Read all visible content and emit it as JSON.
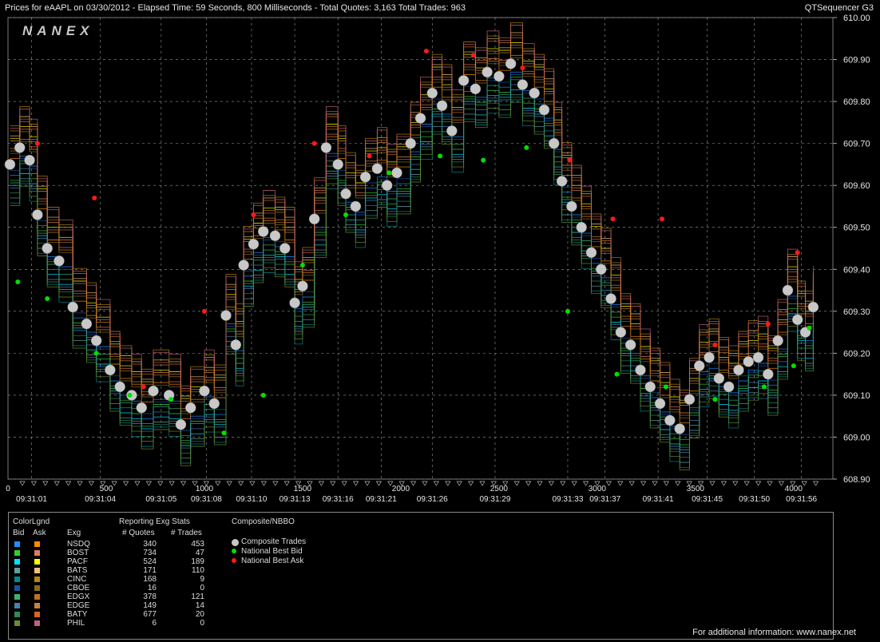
{
  "header": {
    "title": "Prices for  eAAPL  on  03/30/2012  -  Elapsed Time: 59 Seconds, 800 Milliseconds  -  Total Quotes: 3,163  Total Trades: 963",
    "app": "QTSequencer G3",
    "logo": "NANEX"
  },
  "chart_data": {
    "type": "scatter",
    "title": "",
    "xlabel": "",
    "ylabel": "",
    "ylim": [
      608.9,
      610.0
    ],
    "xlim": [
      0,
      4200
    ],
    "y_ticks": [
      "610.00",
      "609.90",
      "609.80",
      "609.70",
      "609.60",
      "609.50",
      "609.40",
      "609.30",
      "609.20",
      "609.10",
      "609.00",
      "608.90"
    ],
    "x_ticks": [
      {
        "v": 0,
        "label": "0"
      },
      {
        "v": 500,
        "label": "500"
      },
      {
        "v": 1000,
        "label": "1000"
      },
      {
        "v": 1500,
        "label": "1500"
      },
      {
        "v": 2000,
        "label": "2000"
      },
      {
        "v": 2500,
        "label": "2500"
      },
      {
        "v": 3000,
        "label": "3000"
      },
      {
        "v": 3500,
        "label": "3500"
      },
      {
        "v": 4000,
        "label": "4000"
      }
    ],
    "time_labels": [
      {
        "v": 120,
        "label": "09:31:01"
      },
      {
        "v": 470,
        "label": "09:31:04"
      },
      {
        "v": 780,
        "label": "09:31:05"
      },
      {
        "v": 1010,
        "label": "09:31:08"
      },
      {
        "v": 1240,
        "label": "09:31:10"
      },
      {
        "v": 1460,
        "label": "09:31:13"
      },
      {
        "v": 1680,
        "label": "09:31:16"
      },
      {
        "v": 1900,
        "label": "09:31:21"
      },
      {
        "v": 2160,
        "label": "09:31:26"
      },
      {
        "v": 2480,
        "label": "09:31:29"
      },
      {
        "v": 2850,
        "label": "09:31:33"
      },
      {
        "v": 3040,
        "label": "09:31:37"
      },
      {
        "v": 3310,
        "label": "09:31:41"
      },
      {
        "v": 3560,
        "label": "09:31:45"
      },
      {
        "v": 3800,
        "label": "09:31:50"
      },
      {
        "v": 4040,
        "label": "09:31:56"
      }
    ],
    "grid": true,
    "legend_position": "bottom",
    "series": [
      {
        "name": "Composite Trades",
        "color": "#c8c8c8",
        "marker": "circle",
        "points": [
          [
            10,
            609.65
          ],
          [
            60,
            609.69
          ],
          [
            110,
            609.66
          ],
          [
            150,
            609.53
          ],
          [
            200,
            609.45
          ],
          [
            260,
            609.42
          ],
          [
            330,
            609.31
          ],
          [
            400,
            609.27
          ],
          [
            450,
            609.23
          ],
          [
            520,
            609.16
          ],
          [
            570,
            609.12
          ],
          [
            630,
            609.1
          ],
          [
            680,
            609.07
          ],
          [
            740,
            609.11
          ],
          [
            820,
            609.1
          ],
          [
            880,
            609.03
          ],
          [
            930,
            609.07
          ],
          [
            1000,
            609.11
          ],
          [
            1050,
            609.08
          ],
          [
            1110,
            609.29
          ],
          [
            1160,
            609.22
          ],
          [
            1200,
            609.41
          ],
          [
            1250,
            609.46
          ],
          [
            1300,
            609.49
          ],
          [
            1360,
            609.48
          ],
          [
            1410,
            609.45
          ],
          [
            1460,
            609.32
          ],
          [
            1500,
            609.36
          ],
          [
            1560,
            609.52
          ],
          [
            1620,
            609.69
          ],
          [
            1680,
            609.65
          ],
          [
            1720,
            609.58
          ],
          [
            1770,
            609.55
          ],
          [
            1820,
            609.62
          ],
          [
            1880,
            609.64
          ],
          [
            1930,
            609.6
          ],
          [
            1980,
            609.63
          ],
          [
            2050,
            609.7
          ],
          [
            2100,
            609.76
          ],
          [
            2160,
            609.82
          ],
          [
            2210,
            609.79
          ],
          [
            2260,
            609.73
          ],
          [
            2320,
            609.85
          ],
          [
            2380,
            609.83
          ],
          [
            2440,
            609.87
          ],
          [
            2500,
            609.86
          ],
          [
            2560,
            609.89
          ],
          [
            2620,
            609.84
          ],
          [
            2680,
            609.82
          ],
          [
            2730,
            609.78
          ],
          [
            2780,
            609.7
          ],
          [
            2820,
            609.61
          ],
          [
            2870,
            609.55
          ],
          [
            2920,
            609.5
          ],
          [
            2970,
            609.44
          ],
          [
            3020,
            609.4
          ],
          [
            3070,
            609.33
          ],
          [
            3120,
            609.25
          ],
          [
            3170,
            609.22
          ],
          [
            3220,
            609.16
          ],
          [
            3270,
            609.12
          ],
          [
            3320,
            609.08
          ],
          [
            3370,
            609.04
          ],
          [
            3420,
            609.02
          ],
          [
            3470,
            609.09
          ],
          [
            3520,
            609.17
          ],
          [
            3570,
            609.19
          ],
          [
            3620,
            609.14
          ],
          [
            3670,
            609.12
          ],
          [
            3720,
            609.16
          ],
          [
            3770,
            609.18
          ],
          [
            3820,
            609.19
          ],
          [
            3870,
            609.15
          ],
          [
            3920,
            609.23
          ],
          [
            3970,
            609.35
          ],
          [
            4020,
            609.28
          ],
          [
            4060,
            609.25
          ],
          [
            4100,
            609.31
          ]
        ]
      },
      {
        "name": "National Best Bid",
        "color": "#00e000",
        "marker": "dot",
        "points": [
          [
            50,
            609.37
          ],
          [
            200,
            609.33
          ],
          [
            450,
            609.2
          ],
          [
            620,
            609.1
          ],
          [
            830,
            609.09
          ],
          [
            1100,
            609.01
          ],
          [
            1300,
            609.1
          ],
          [
            1500,
            609.41
          ],
          [
            1720,
            609.53
          ],
          [
            1940,
            609.63
          ],
          [
            2200,
            609.67
          ],
          [
            2420,
            609.66
          ],
          [
            2640,
            609.69
          ],
          [
            2850,
            609.3
          ],
          [
            3100,
            609.15
          ],
          [
            3350,
            609.12
          ],
          [
            3600,
            609.09
          ],
          [
            3850,
            609.12
          ],
          [
            4000,
            609.17
          ],
          [
            4080,
            609.26
          ]
        ]
      },
      {
        "name": "National Best Ask",
        "color": "#ff1a1a",
        "marker": "dot",
        "points": [
          [
            150,
            609.7
          ],
          [
            440,
            609.57
          ],
          [
            690,
            609.12
          ],
          [
            1000,
            609.3
          ],
          [
            1250,
            609.53
          ],
          [
            1560,
            609.7
          ],
          [
            1840,
            609.67
          ],
          [
            2130,
            609.92
          ],
          [
            2370,
            609.91
          ],
          [
            2620,
            609.88
          ],
          [
            2860,
            609.66
          ],
          [
            3080,
            609.52
          ],
          [
            3330,
            609.52
          ],
          [
            3600,
            609.22
          ],
          [
            3870,
            609.27
          ],
          [
            4020,
            609.44
          ]
        ]
      }
    ]
  },
  "legend": {
    "col_colorlgnd": "ColorLgnd",
    "col_bid": "Bid",
    "col_ask": "Ask",
    "col_exg": "Exg",
    "col_stats": "Reporting Exg Stats",
    "col_quotes": "# Quotes",
    "col_trades": "# Trades",
    "col_composite": "Composite/NBBO",
    "rows": [
      {
        "exg": "NSDQ",
        "quotes": "340",
        "trades": "453",
        "bid": "#1e90ff",
        "ask": "#ff8c00"
      },
      {
        "exg": "BOST",
        "quotes": "734",
        "trades": "47",
        "bid": "#32cd32",
        "ask": "#e07a5f"
      },
      {
        "exg": "PACF",
        "quotes": "524",
        "trades": "189",
        "bid": "#00e5ff",
        "ask": "#ffff00"
      },
      {
        "exg": "BATS",
        "quotes": "171",
        "trades": "110",
        "bid": "#5f9ea0",
        "ask": "#f0c080"
      },
      {
        "exg": "CINC",
        "quotes": "168",
        "trades": "9",
        "bid": "#008b8b",
        "ask": "#b8860b"
      },
      {
        "exg": "CBOE",
        "quotes": "16",
        "trades": "0",
        "bid": "#1f4fa0",
        "ask": "#8b6b20"
      },
      {
        "exg": "EDGX",
        "quotes": "378",
        "trades": "121",
        "bid": "#3cb371",
        "ask": "#c07020"
      },
      {
        "exg": "EDGE",
        "quotes": "149",
        "trades": "14",
        "bid": "#4682b4",
        "ask": "#cd8040"
      },
      {
        "exg": "BATY",
        "quotes": "677",
        "trades": "20",
        "bid": "#2e8b57",
        "ask": "#d2691e"
      },
      {
        "exg": "PHIL",
        "quotes": "6",
        "trades": "0",
        "bid": "#6b8e23",
        "ask": "#c06080"
      }
    ],
    "composite": [
      {
        "label": "Composite Trades",
        "color": "#c8c8c8"
      },
      {
        "label": "National Best Bid",
        "color": "#00e000"
      },
      {
        "label": "National Best Ask",
        "color": "#ff1a1a"
      }
    ]
  },
  "footer": {
    "text": "For additional information: www.nanex.net"
  }
}
